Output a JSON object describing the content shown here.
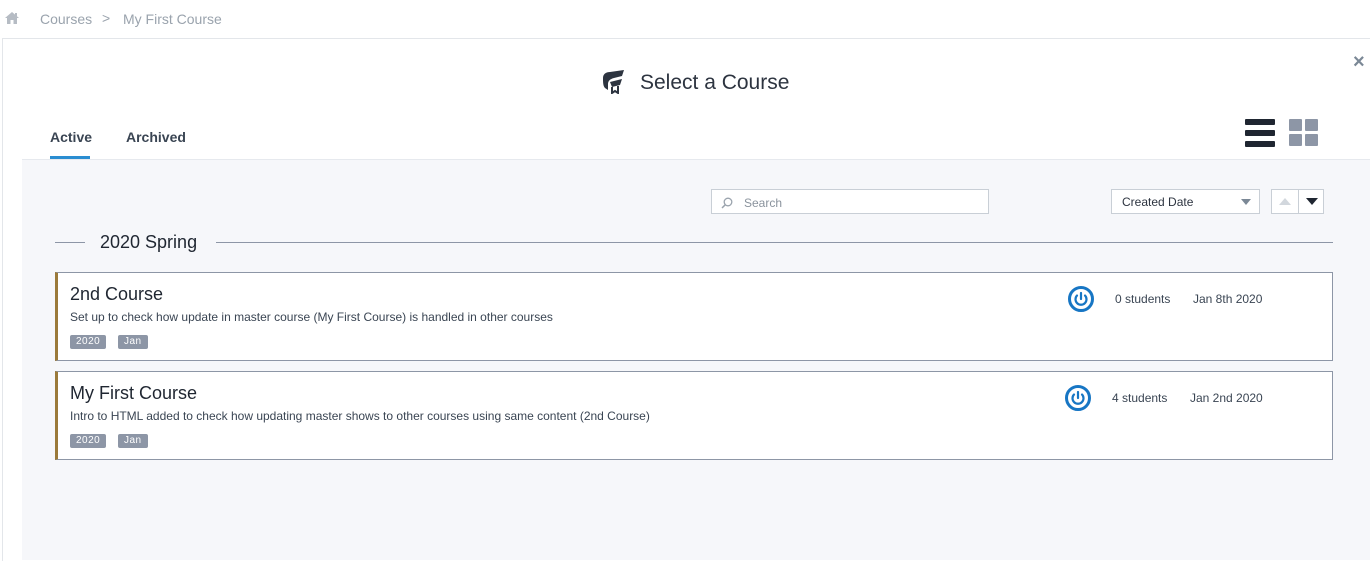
{
  "breadcrumb": {
    "home_icon": "home-icon",
    "items": [
      "Courses",
      "My First Course"
    ],
    "separator": ">"
  },
  "modal": {
    "title": "Select a Course",
    "title_icon": "graduation-cap-icon",
    "close_label": "×"
  },
  "tabs": [
    {
      "label": "Active",
      "active": true
    },
    {
      "label": "Archived",
      "active": false
    }
  ],
  "view_toggle": {
    "list_icon": "list-view-icon",
    "grid_icon": "grid-view-icon",
    "selected": "list"
  },
  "search": {
    "placeholder": "Search",
    "value": ""
  },
  "sort": {
    "selected": "Created Date",
    "direction": "descending"
  },
  "group": {
    "title": "2020 Spring"
  },
  "courses": [
    {
      "title": "2nd Course",
      "description": "Set up to check how update in master course (My First Course) is handled in other courses",
      "tags": [
        "2020",
        "Jan"
      ],
      "students": "0 students",
      "date": "Jan 8th 2020"
    },
    {
      "title": "My First Course",
      "description": "Intro to HTML added to check how updating master shows to other courses using same content (2nd Course)",
      "tags": [
        "2020",
        "Jan"
      ],
      "students": "4 students",
      "date": "Jan 2nd 2020"
    }
  ],
  "colors": {
    "accent": "#2a8dd1",
    "card_left_border": "#9b7a3a",
    "tag_bg": "#8d96a6",
    "power_icon": "#1776c4"
  }
}
